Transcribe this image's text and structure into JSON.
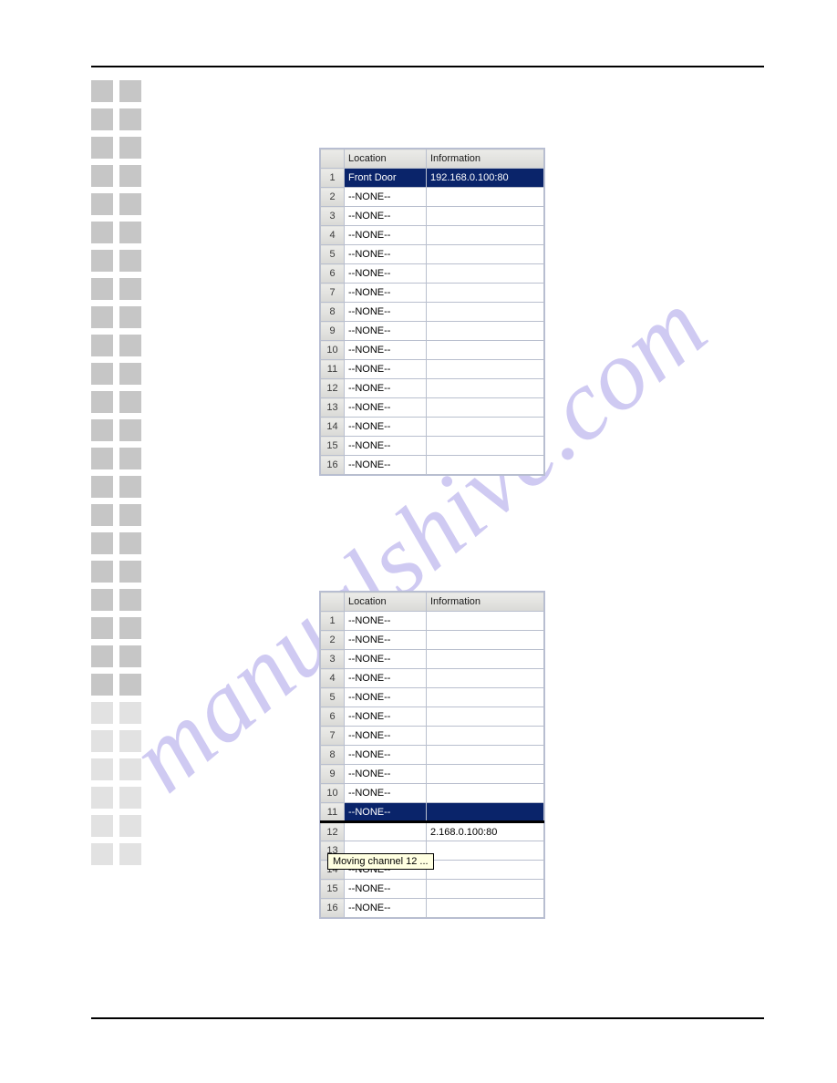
{
  "watermark_text": "manualshive.com",
  "table1": {
    "headers": {
      "location": "Location",
      "information": "Information"
    },
    "rows": [
      {
        "n": "1",
        "location": "Front Door",
        "info": "192.168.0.100:80",
        "selected": true
      },
      {
        "n": "2",
        "location": "--NONE--",
        "info": ""
      },
      {
        "n": "3",
        "location": "--NONE--",
        "info": ""
      },
      {
        "n": "4",
        "location": "--NONE--",
        "info": ""
      },
      {
        "n": "5",
        "location": "--NONE--",
        "info": ""
      },
      {
        "n": "6",
        "location": "--NONE--",
        "info": ""
      },
      {
        "n": "7",
        "location": "--NONE--",
        "info": ""
      },
      {
        "n": "8",
        "location": "--NONE--",
        "info": ""
      },
      {
        "n": "9",
        "location": "--NONE--",
        "info": ""
      },
      {
        "n": "10",
        "location": "--NONE--",
        "info": ""
      },
      {
        "n": "11",
        "location": "--NONE--",
        "info": ""
      },
      {
        "n": "12",
        "location": "--NONE--",
        "info": ""
      },
      {
        "n": "13",
        "location": "--NONE--",
        "info": ""
      },
      {
        "n": "14",
        "location": "--NONE--",
        "info": ""
      },
      {
        "n": "15",
        "location": "--NONE--",
        "info": ""
      },
      {
        "n": "16",
        "location": "--NONE--",
        "info": ""
      }
    ]
  },
  "table2": {
    "headers": {
      "location": "Location",
      "information": "Information"
    },
    "rows": [
      {
        "n": "1",
        "location": "--NONE--",
        "info": ""
      },
      {
        "n": "2",
        "location": "--NONE--",
        "info": ""
      },
      {
        "n": "3",
        "location": "--NONE--",
        "info": ""
      },
      {
        "n": "4",
        "location": "--NONE--",
        "info": ""
      },
      {
        "n": "5",
        "location": "--NONE--",
        "info": ""
      },
      {
        "n": "6",
        "location": "--NONE--",
        "info": ""
      },
      {
        "n": "7",
        "location": "--NONE--",
        "info": ""
      },
      {
        "n": "8",
        "location": "--NONE--",
        "info": ""
      },
      {
        "n": "9",
        "location": "--NONE--",
        "info": ""
      },
      {
        "n": "10",
        "location": "--NONE--",
        "info": ""
      },
      {
        "n": "11",
        "location": "--NONE--",
        "info": "",
        "selected": true
      },
      {
        "n": "12",
        "location": "",
        "info": "2.168.0.100:80",
        "drop": true
      },
      {
        "n": "13",
        "location": "",
        "info": ""
      },
      {
        "n": "14",
        "location": "--NONE--",
        "info": ""
      },
      {
        "n": "15",
        "location": "--NONE--",
        "info": ""
      },
      {
        "n": "16",
        "location": "--NONE--",
        "info": ""
      }
    ],
    "tooltip": "Moving channel 12 ..."
  }
}
